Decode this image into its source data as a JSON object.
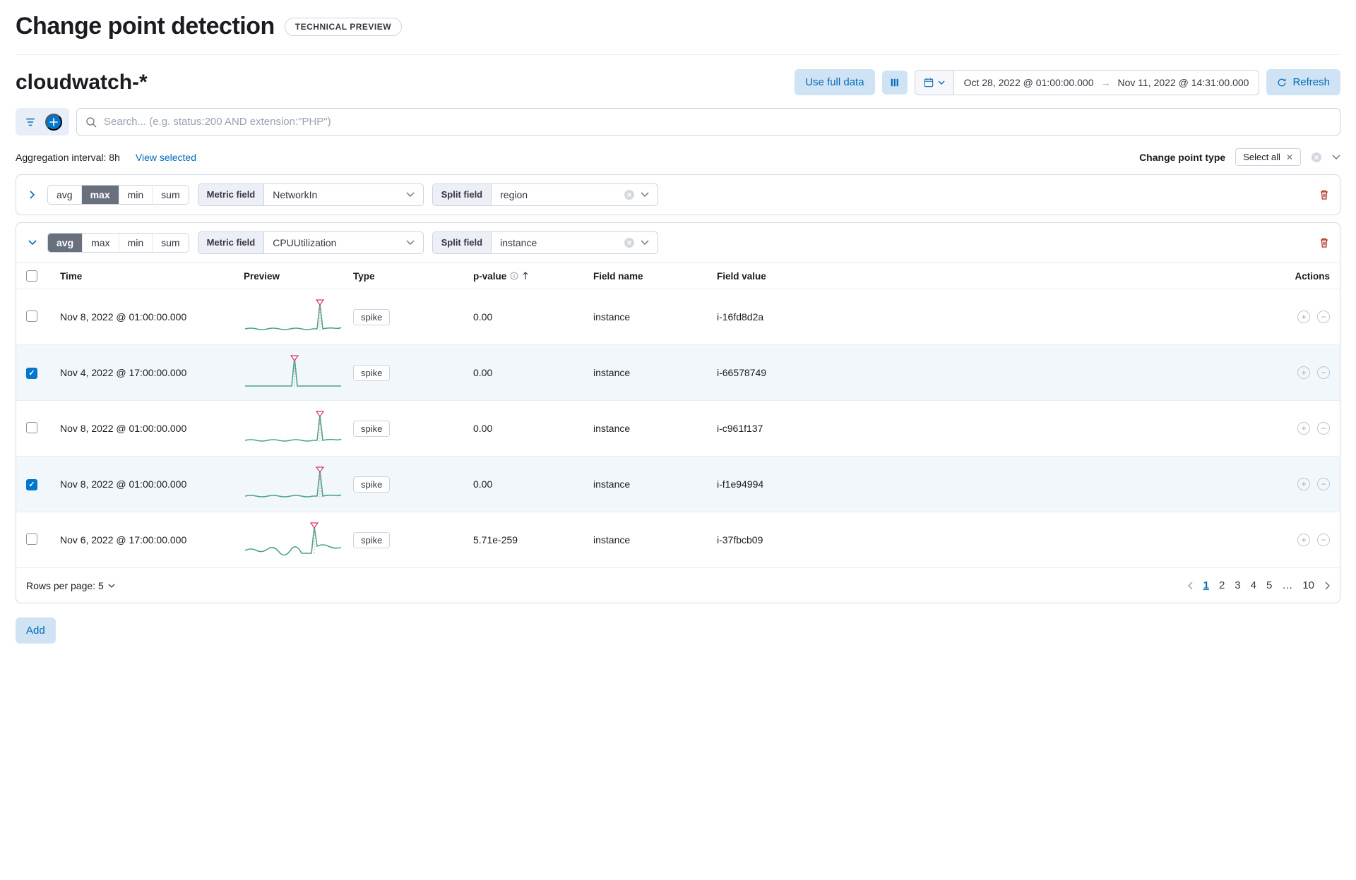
{
  "header": {
    "title": "Change point detection",
    "preview_badge": "TECHNICAL PREVIEW"
  },
  "index": {
    "title": "cloudwatch-*"
  },
  "toolbar": {
    "use_full_data": "Use full data",
    "date_from": "Oct 28, 2022 @ 01:00:00.000",
    "date_to": "Nov 11, 2022 @ 14:31:00.000",
    "refresh": "Refresh"
  },
  "search": {
    "placeholder": "Search... (e.g. status:200 AND extension:\"PHP\")"
  },
  "info": {
    "aggregation_interval_label": "Aggregation interval: 8h",
    "view_selected": "View selected",
    "cp_type_label": "Change point type",
    "select_all_chip": "Select all"
  },
  "agg_options": [
    "avg",
    "max",
    "min",
    "sum"
  ],
  "configs": [
    {
      "expanded": false,
      "active_agg": "max",
      "metric_field_label": "Metric field",
      "metric_field_value": "NetworkIn",
      "split_field_label": "Split field",
      "split_field_value": "region"
    },
    {
      "expanded": true,
      "active_agg": "avg",
      "metric_field_label": "Metric field",
      "metric_field_value": "CPUUtilization",
      "split_field_label": "Split field",
      "split_field_value": "instance"
    }
  ],
  "columns": {
    "time": "Time",
    "preview": "Preview",
    "type": "Type",
    "pvalue": "p-value",
    "field_name": "Field name",
    "field_value": "Field value",
    "actions": "Actions"
  },
  "rows": [
    {
      "selected": false,
      "time": "Nov 8, 2022 @ 01:00:00.000",
      "type": "spike",
      "pvalue": "0.00",
      "field_name": "instance",
      "field_value": "i-16fd8d2a",
      "spark": 1
    },
    {
      "selected": true,
      "time": "Nov 4, 2022 @ 17:00:00.000",
      "type": "spike",
      "pvalue": "0.00",
      "field_name": "instance",
      "field_value": "i-66578749",
      "spark": 2
    },
    {
      "selected": false,
      "time": "Nov 8, 2022 @ 01:00:00.000",
      "type": "spike",
      "pvalue": "0.00",
      "field_name": "instance",
      "field_value": "i-c961f137",
      "spark": 1
    },
    {
      "selected": true,
      "time": "Nov 8, 2022 @ 01:00:00.000",
      "type": "spike",
      "pvalue": "0.00",
      "field_name": "instance",
      "field_value": "i-f1e94994",
      "spark": 1
    },
    {
      "selected": false,
      "time": "Nov 6, 2022 @ 17:00:00.000",
      "type": "spike",
      "pvalue": "5.71e-259",
      "field_name": "instance",
      "field_value": "i-37fbcb09",
      "spark": 3
    }
  ],
  "pagination": {
    "rows_per_page_label": "Rows per page: 5",
    "pages": [
      "1",
      "2",
      "3",
      "4",
      "5",
      "…",
      "10"
    ],
    "active": "1"
  },
  "footer": {
    "add": "Add"
  }
}
